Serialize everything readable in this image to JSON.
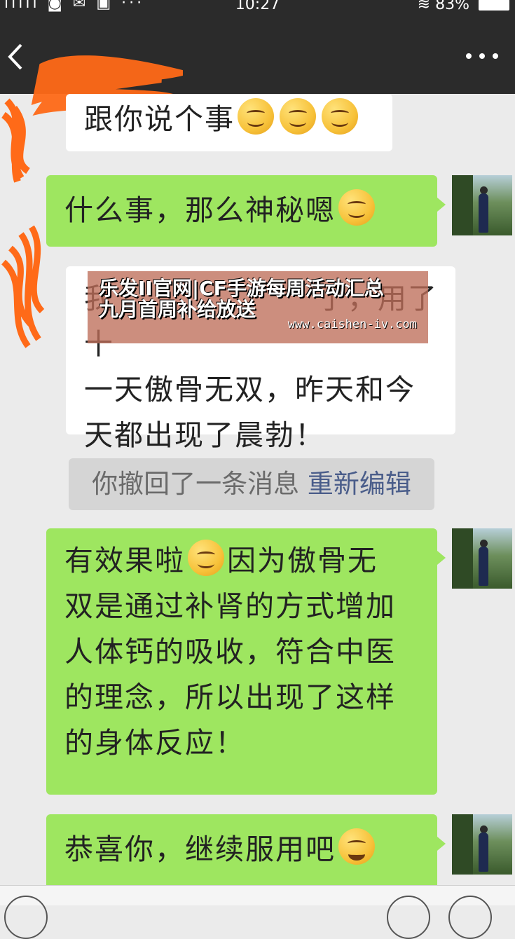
{
  "status_bar": {
    "left_icons": "ıllll ◙ ✉ ▣ ···",
    "time": "10:27",
    "battery": "83%"
  },
  "nav": {
    "back_icon": "chevron-left-icon",
    "more_icon": "more-dots-icon"
  },
  "messages": [
    {
      "side": "left",
      "text": "跟你说个事"
    },
    {
      "side": "right",
      "text": "什么事，那么神秘嗯"
    },
    {
      "side": "left",
      "lines": [
        "我",
        "了，用了十",
        "一天傲骨无双，昨天和今",
        "天都出现了晨勃！"
      ]
    },
    {
      "side": "right",
      "lines": [
        "有效果啦",
        "因为傲骨无",
        "双是通过补肾的方式增加",
        "人体钙的吸收，符合中医",
        "的理念，所以出现了这样",
        "的身体反应！"
      ]
    },
    {
      "side": "right",
      "text": "恭喜你，继续服用吧"
    }
  ],
  "recall": {
    "text": "你撤回了一条消息",
    "edit_label": "重新编辑"
  },
  "watermark": {
    "title_line1": "乐发II官网|CF手游每周活动汇总",
    "title_line2": "九月首周补给放送",
    "url": "www.caishen-iv.com"
  },
  "colors": {
    "green_bubble": "#9ee660",
    "header": "#2b2b2b",
    "background": "#ebebeb"
  }
}
